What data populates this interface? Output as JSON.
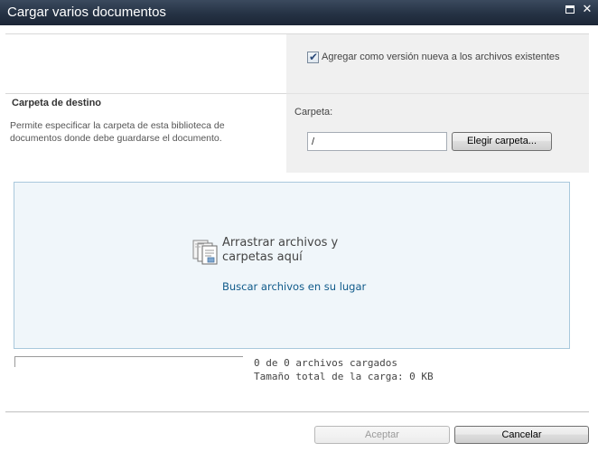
{
  "dialog": {
    "title": "Cargar varios documentos"
  },
  "options": {
    "overwrite_checked": true,
    "overwrite_label": "Agregar como versión nueva a los archivos existentes"
  },
  "destination": {
    "section_title": "Carpeta de destino",
    "section_description": "Permite especificar la carpeta de esta biblioteca de documentos donde debe guardarse el documento.",
    "folder_label": "Carpeta:",
    "folder_value": "/",
    "choose_folder_button": "Elegir carpeta..."
  },
  "dropzone": {
    "instruction": "Arrastrar archivos y carpetas aquí",
    "browse_link": "Buscar archivos en su lugar",
    "icon": "documents-icon"
  },
  "upload_status": {
    "progress_fraction": 0,
    "files_uploaded_text": "0 de 0 archivos cargados",
    "total_size_text": "Tamaño total de la carga: 0 KB"
  },
  "footer": {
    "ok_label": "Aceptar",
    "cancel_label": "Cancelar"
  },
  "icons": {
    "maximize": "maximize-icon",
    "close": "close-icon"
  },
  "colors": {
    "titlebar": "#253244",
    "dropzone_background": "#f0f6fa",
    "dropzone_border": "#a9c8dc",
    "link": "#0f5a8a"
  }
}
